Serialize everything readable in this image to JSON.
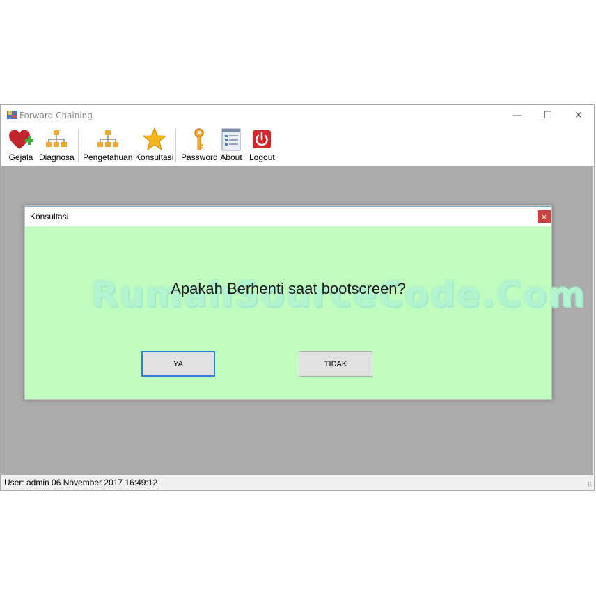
{
  "window": {
    "title": "Forward Chaining",
    "controls": {
      "minimize": "—",
      "maximize": "☐",
      "close": "✕"
    }
  },
  "toolbar": {
    "items": [
      {
        "label": "Gejala",
        "icon": "heart-plus-icon"
      },
      {
        "label": "Diagnosa",
        "icon": "org-chart-icon"
      },
      {
        "label": "Pengetahuan",
        "icon": "org-chart-icon"
      },
      {
        "label": "Konsultasi",
        "icon": "star-icon"
      },
      {
        "label": "Password",
        "icon": "key-icon"
      },
      {
        "label": "About",
        "icon": "document-icon"
      },
      {
        "label": "Logout",
        "icon": "power-icon"
      }
    ]
  },
  "dialog": {
    "title": "Konsultasi",
    "close": "×",
    "question": "Apakah Berhenti saat bootscreen?",
    "yes_label": "YA",
    "no_label": "TIDAK",
    "watermark": "RumahSourceCode.Com"
  },
  "status": {
    "text": "User: admin  06 November 2017 16:49:12"
  },
  "colors": {
    "dialog_bg": "#c0fcc0",
    "mdi_bg": "#ababab",
    "focus_border": "#2f7fd6",
    "close_red": "#c7433f"
  }
}
